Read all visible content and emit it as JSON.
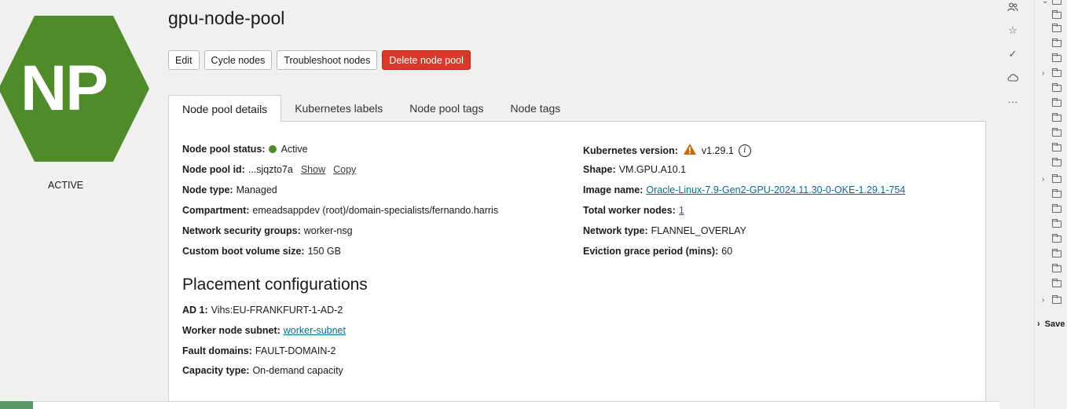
{
  "badge": {
    "initials": "NP",
    "color": "#4f8a2b",
    "status": "ACTIVE"
  },
  "page": {
    "title": "gpu-node-pool"
  },
  "actions": {
    "edit": "Edit",
    "cycle": "Cycle nodes",
    "troubleshoot": "Troubleshoot nodes",
    "delete": "Delete node pool"
  },
  "tabs": [
    "Node pool details",
    "Kubernetes labels",
    "Node pool tags",
    "Node tags"
  ],
  "details_left": {
    "status_label": "Node pool status:",
    "status_value": "Active",
    "id_label": "Node pool id:",
    "id_value": "...sjqzto7a",
    "id_show": "Show",
    "id_copy": "Copy",
    "type_label": "Node type:",
    "type_value": "Managed",
    "compartment_label": "Compartment:",
    "compartment_value": "emeadsappdev (root)/domain-specialists/fernando.harris",
    "nsg_label": "Network security groups:",
    "nsg_value": "worker-nsg",
    "boot_label": "Custom boot volume size:",
    "boot_value": "150 GB"
  },
  "details_right": {
    "k8s_label": "Kubernetes version:",
    "k8s_value": "v1.29.1",
    "shape_label": "Shape:",
    "shape_value": "VM.GPU.A10.1",
    "image_label": "Image name:",
    "image_value": "Oracle-Linux-7.9-Gen2-GPU-2024.11.30-0-OKE-1.29.1-754",
    "workers_label": "Total worker nodes:",
    "workers_value": "1",
    "nettype_label": "Network type:",
    "nettype_value": "FLANNEL_OVERLAY",
    "grace_label": "Eviction grace period (mins):",
    "grace_value": "60"
  },
  "placement": {
    "title": "Placement configurations",
    "ad_label": "AD 1:",
    "ad_value": "Vihs:EU-FRANKFURT-1-AD-2",
    "subnet_label": "Worker node subnet:",
    "subnet_value": "worker-subnet",
    "fault_label": "Fault domains:",
    "fault_value": "FAULT-DOMAIN-2",
    "capacity_label": "Capacity type:",
    "capacity_value": "On-demand capacity"
  },
  "side": {
    "saved_label": "Save"
  },
  "colors": {
    "accent": "#0c6a8e",
    "danger": "#d9392b",
    "active_dot": "#4e8a2e",
    "warning": "#c96a10"
  }
}
